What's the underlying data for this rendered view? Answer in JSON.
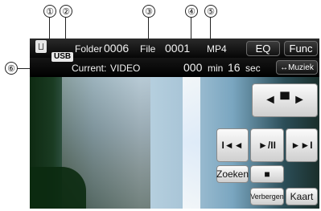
{
  "callouts": [
    "①",
    "②",
    "③",
    "④",
    "⑤",
    "⑥"
  ],
  "topbar": {
    "usb_label": "USB",
    "folder_label": "Folder",
    "folder_value": "0006",
    "file_label": "File",
    "file_value": "0001",
    "format": "MP4",
    "eq_label": "EQ",
    "func_label": "Func"
  },
  "secondbar": {
    "current_label": "Current:",
    "current_value": "VIDEO",
    "time_min_value": "000",
    "time_min_unit": "min",
    "time_sec_value": "16",
    "time_sec_unit": "sec",
    "source_button": "↔Muziek"
  },
  "controls": {
    "folder_nav": "◄ ▀ ►",
    "prev": "I◄◄",
    "play_pause": "►/II",
    "next": "►►I",
    "search": "Zoeken",
    "stop": "■",
    "hide": "Verbergen",
    "map": "Kaart"
  }
}
